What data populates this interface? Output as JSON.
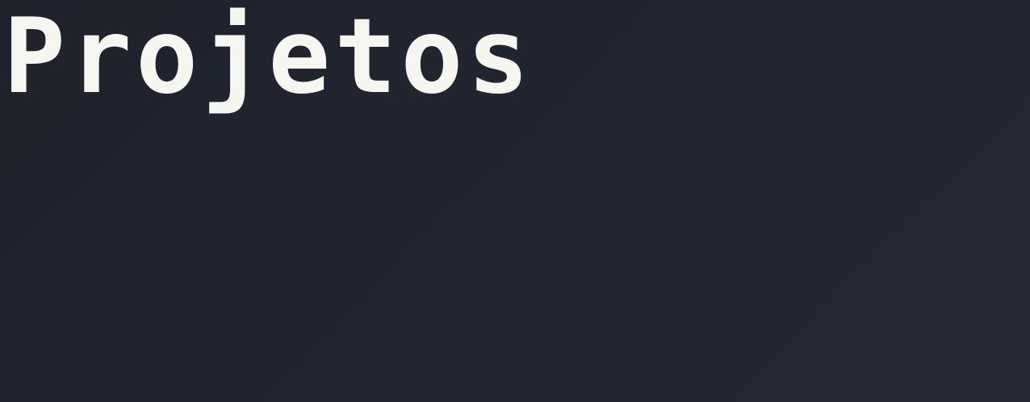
{
  "header": {
    "title": "Projetos"
  },
  "colors": {
    "background": "#22252f",
    "title_text": "#f5f6ef"
  }
}
